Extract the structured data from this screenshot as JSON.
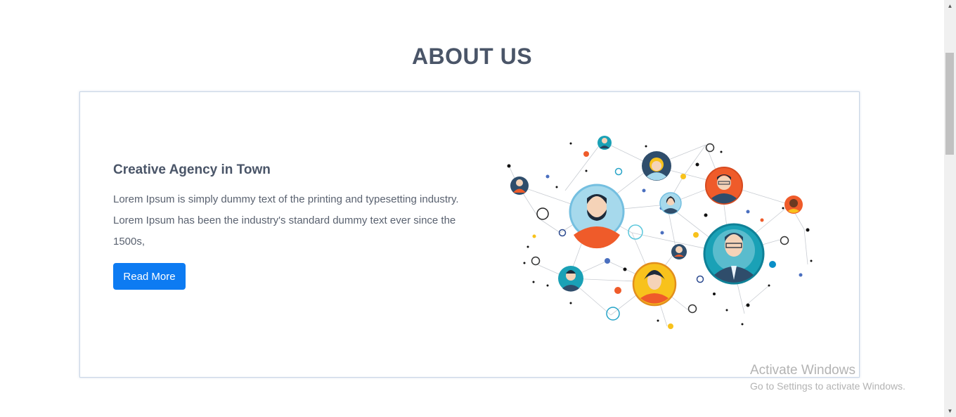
{
  "page": {
    "title": "ABOUT US"
  },
  "card": {
    "heading": "Creative Agency in Town",
    "text": "Lorem Ipsum is simply dummy text of the printing and typesetting industry. Lorem Ipsum has been the industry's standard dummy text ever since the 1500s,",
    "button_label": "Read More"
  },
  "illustration": {
    "icon": "people-network-illustration"
  },
  "watermark": {
    "title": "Activate Windows",
    "subtitle": "Go to Settings to activate Windows."
  },
  "colors": {
    "accent": "#0d7bf2",
    "heading": "#4a5568",
    "body_text": "#5a6270",
    "card_border": "#c9d6e6"
  }
}
